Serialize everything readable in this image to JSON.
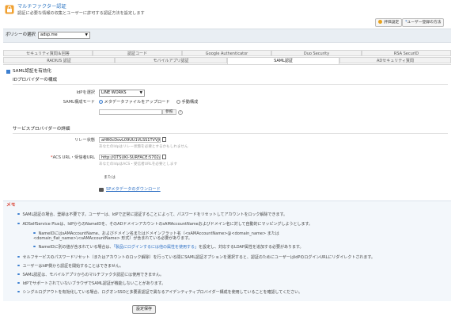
{
  "header": {
    "title": "マルチファクター認証",
    "subtitle": "認証に必要な情報の収集とユーザーに許可する認証方法を設定します",
    "btn_eval": "評価設定",
    "btn_user_reg": "ユーザー登録の方法"
  },
  "policy": {
    "label": "ポリシーの選択",
    "selected": "adsp.me"
  },
  "tabs_row1": [
    "セキュリティ質問＆回答",
    "認証コード",
    "Google Authenticator",
    "Duo Security",
    "RSA SecurID"
  ],
  "tabs_row2": [
    "RADIUS 認証",
    "モバイルアプリ認証",
    "SAML認証",
    "ADセキュリティ質問"
  ],
  "active_tab": "SAML認証",
  "saml": {
    "enable_label": "SAML認証を有効化",
    "idp_section": "IDプロバイダーの構成",
    "idp_select_label": "IdPを選択",
    "idp_selected": "LINE WORKS",
    "mode_label": "SAML構成モード",
    "mode_option_upload": "メタデータファイルをアップロード",
    "mode_option_manual": "手動構成",
    "browse_label": "参照",
    "help_glyph": "?",
    "sp_section": "サービスプロバイダーの詳細",
    "relay_label": "リレー状態",
    "relay_value": "aHR0cDovL09UU1VLSS1TVVJGQ",
    "relay_hint": "あなたのIdpはリレー状態を必要とするかもしれません",
    "acs_label": "ACS URL・受信者URL",
    "acs_value": "http://OTSUKI-SURFACE:5702/s",
    "acs_hint": "あなたのIdpはACS・受信者URLを必要とします",
    "or_label": "または",
    "metadata_link": "SPメタデータのダウンロード"
  },
  "memo": {
    "title": "メモ",
    "items": [
      "SAML認証の場合、登録は不要です。ユーザーは、IdPで正常に認証することによって、パスワードをリセットしてアカウントをロック解除できます。",
      "ADSelfService Plusは、IdPからのNameIDを、そのADドメインアカウントのsAMAccountNameおよびドメイン名に対して自動的にマッピングしようとします。",
      "NameIDにはsAMAccountName、およびドメイン名またはドメインフラット名（<sAMAccountName>@<domain_name> または <domain_flat_name>\\<sAMAccountName> 形式）が含まれている必要があります。",
      "NameIDに別の値が含まれている場合は、「製品にログインするには他の属性を使用する」を設定し、対応するLDAP属性を追加する必要があります。",
      "セルフサービスのパスワードリセット（またはアカウントのロック解除）を行っている間にSAML認証オプションを選択すると、認証のためにユーザーはIdPのログインURLにリダイレクトされます。",
      "ユーザーはIdP側から認証を開始することはできません。",
      "SAML認証は、モバイルアプリからのマルチファクタ認証には使用できません。",
      "IdPでサポートされていないブラウザでSAML認証が機能しないことがあります。",
      "シングルログアウトを有効化している場合、ログオンSSOと多要素認証で異なるアイデンティティプロバイダー構成を使用していることを確認してください。"
    ],
    "item4_link": "「製品にログインするには他の属性を使用する」"
  },
  "save_button": "設定保存"
}
